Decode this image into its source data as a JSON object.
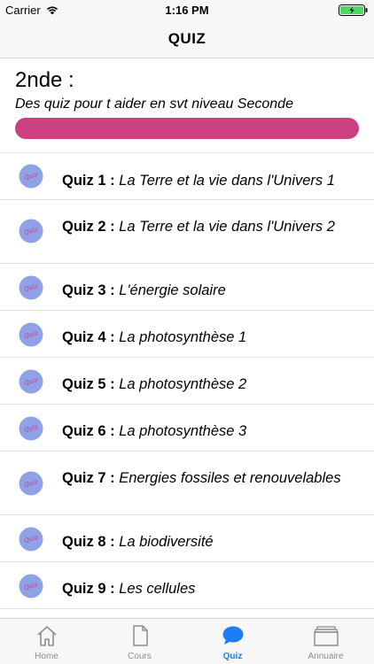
{
  "status_bar": {
    "carrier": "Carrier",
    "time": "1:16 PM"
  },
  "nav": {
    "title": "QUIZ"
  },
  "header": {
    "level": "2nde :",
    "subtitle": "Des quiz pour t aider en svt niveau Seconde",
    "bar_color": "#cc3f80"
  },
  "quizzes": [
    {
      "number": "Quiz 1 :",
      "title": "La Terre et la vie dans l'Univers 1"
    },
    {
      "number": "Quiz 2 :",
      "title": "La Terre et la vie dans l'Univers 2"
    },
    {
      "number": "Quiz 3 :",
      "title": "L'énergie solaire"
    },
    {
      "number": "Quiz 4 :",
      "title": "La photosynthèse 1"
    },
    {
      "number": "Quiz 5 :",
      "title": "La photosynthèse 2"
    },
    {
      "number": "Quiz 6 :",
      "title": "La photosynthèse 3"
    },
    {
      "number": "Quiz 7 :",
      "title": "Energies fossiles et renouvelables"
    },
    {
      "number": "Quiz 8 :",
      "title": "La biodiversité"
    },
    {
      "number": "Quiz 9 :",
      "title": "Les cellules"
    }
  ],
  "quiz_icon_label": "Quiz",
  "tabs": [
    {
      "label": "Home",
      "icon": "home-icon",
      "active": false
    },
    {
      "label": "Cours",
      "icon": "document-icon",
      "active": false
    },
    {
      "label": "Quiz",
      "icon": "chat-bubble-icon",
      "active": true
    },
    {
      "label": "Annuaire",
      "icon": "folder-stack-icon",
      "active": false
    }
  ],
  "colors": {
    "accent": "#1b7ef5",
    "tab_inactive": "#8e8e93",
    "quiz_icon_bg": "#8fa2e6",
    "quiz_icon_text": "#d0339a",
    "battery": "#4cd964"
  }
}
